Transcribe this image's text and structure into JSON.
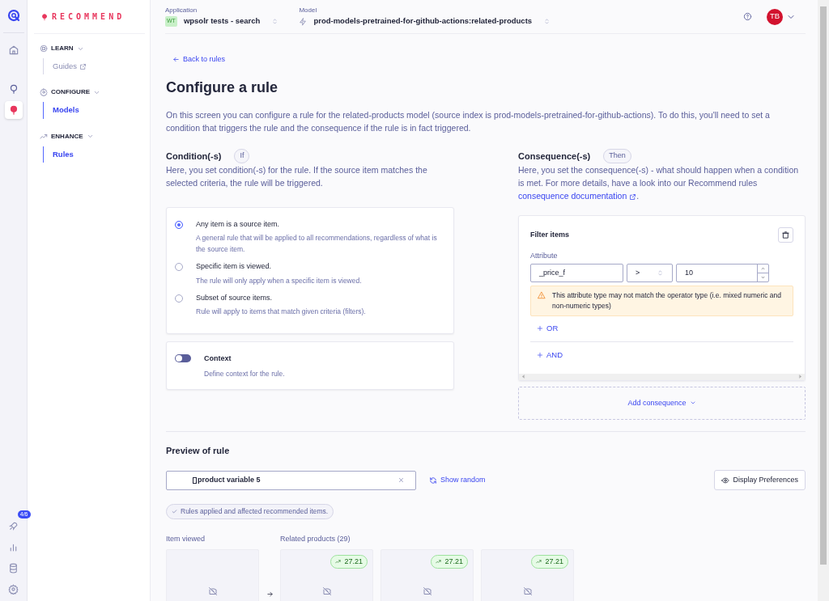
{
  "rail": {
    "items": [
      {
        "kind": "home",
        "selected": false
      },
      {
        "kind": "search",
        "selected": false
      },
      {
        "kind": "recommend",
        "selected": true
      }
    ],
    "bottom": [
      {
        "kind": "rocket",
        "badge": "4/6"
      },
      {
        "kind": "chart"
      },
      {
        "kind": "database"
      },
      {
        "kind": "settings"
      }
    ]
  },
  "brand": "RECOMMEND",
  "sidebar": [
    {
      "kind": "learn",
      "label": "LEARN",
      "items": [
        {
          "label": "Guides",
          "external": true,
          "selected": false
        }
      ]
    },
    {
      "kind": "configure",
      "label": "CONFIGURE",
      "items": [
        {
          "label": "Models",
          "external": false,
          "selected": true
        }
      ]
    },
    {
      "kind": "enhance",
      "label": "ENHANCE",
      "items": [
        {
          "label": "Rules",
          "external": false,
          "selected": true
        }
      ]
    }
  ],
  "topbar": {
    "application": {
      "label": "Application",
      "badge": "WT",
      "value": "wpsolr tests - search"
    },
    "model": {
      "label": "Model",
      "value": "prod-models-pretrained-for-github-actions:related-products"
    },
    "avatar": "TB"
  },
  "back_link": "Back to rules",
  "title": "Configure a rule",
  "intro": "On this screen you can configure a rule for the related-products model (source index is prod-models-pretrained-for-github-actions). To do this, you'll need to set a condition that triggers the rule and the consequence if the rule is in fact triggered.",
  "condition": {
    "heading": "Condition(-s)",
    "tag": "If",
    "description": "Here, you set condition(-s) for the rule. If the source item matches the selected criteria, the rule will be triggered.",
    "options": [
      {
        "label": "Any item is a source item.",
        "description": "A general rule that will be applied to all recommendations, regardless of what is the source item.",
        "selected": true
      },
      {
        "label": "Specific item is viewed.",
        "description": "The rule will only apply when a specific item is viewed.",
        "selected": false
      },
      {
        "label": "Subset of source items.",
        "description": "Rule will apply to items that match given criteria (filters).",
        "selected": false
      }
    ],
    "context": {
      "label": "Context",
      "description": "Define context for the rule.",
      "on": false
    }
  },
  "consequence": {
    "heading": "Consequence(-s)",
    "tag": "Then",
    "description": "Here, you set the consequence(-s) - what should happen when a condition is met. For more details, have a look into our Recommend rules",
    "link": "consequence documentation",
    "link_suffix": ".",
    "filter": {
      "title": "Filter items",
      "attribute_label": "Attribute",
      "attribute": "_price_f",
      "operator": ">",
      "value": "10",
      "warning": "This attribute type may not match the operator type (i.e. mixed numeric and non-numeric types)",
      "or": "OR",
      "and": "AND"
    },
    "add": "Add consequence"
  },
  "preview": {
    "heading": "Preview of rule",
    "search_value": "product variable 5",
    "show_random": "Show random",
    "display_preferences": "Display Preferences",
    "status": "Rules applied and affected recommended items.",
    "item_viewed": "Item viewed",
    "related": "Related products (29)",
    "products": [
      {
        "score": "27.21"
      },
      {
        "score": "27.21"
      },
      {
        "score": "27.21"
      }
    ]
  }
}
